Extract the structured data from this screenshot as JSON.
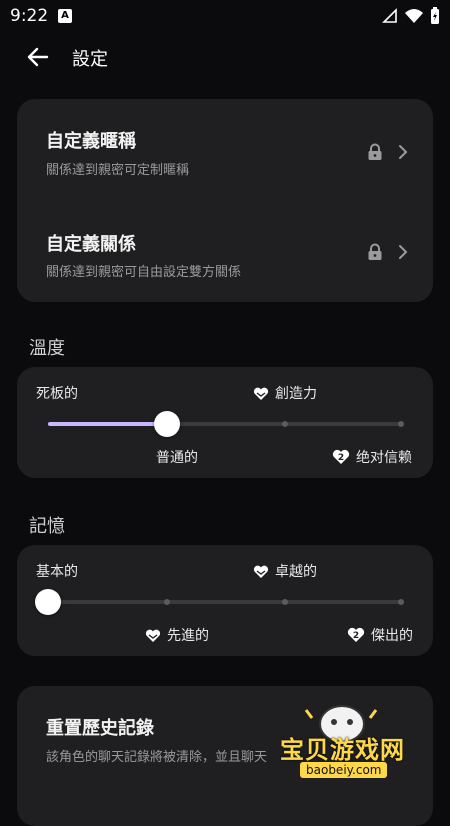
{
  "status_bar": {
    "time": "9:22",
    "a_badge": "A"
  },
  "header": {
    "title": "設定"
  },
  "custom_card": {
    "rows": [
      {
        "title": "自定義暱稱",
        "subtitle": "關係達到親密可定制暱稱"
      },
      {
        "title": "自定義關係",
        "subtitle": "關係達到親密可自由設定雙方關係"
      }
    ]
  },
  "temperature": {
    "label": "溫度",
    "levels": [
      "死板的",
      "普通的",
      "創造力",
      "绝对信赖"
    ],
    "badges": {
      "level_4": "2"
    },
    "value_index": 1,
    "steps": 4
  },
  "memory": {
    "label": "記憶",
    "levels": [
      "基本的",
      "先進的",
      "卓越的",
      "傑出的"
    ],
    "badges": {
      "level_4": "2"
    },
    "value_index": 0,
    "steps": 4
  },
  "reset_card": {
    "title": "重置歷史記錄",
    "subtitle": "該角色的聊天記錄將被清除，並且聊天"
  },
  "watermark": {
    "text": "宝贝游戏网",
    "url": "baobeiy.com"
  },
  "colors": {
    "accent": "#c9b6ff",
    "card": "#1f1f21",
    "background": "#0b0b0d"
  }
}
